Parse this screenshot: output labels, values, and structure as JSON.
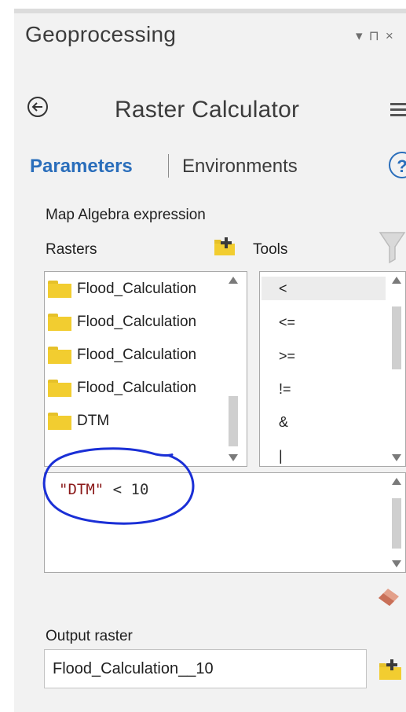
{
  "pane": {
    "title": "Geoprocessing",
    "controls": [
      "▾",
      "⊓",
      "×"
    ]
  },
  "tool": {
    "title": "Raster Calculator"
  },
  "tabs": {
    "parameters": "Parameters",
    "environments": "Environments",
    "help": "?"
  },
  "form": {
    "expression_label": "Map Algebra expression",
    "rasters_label": "Rasters",
    "tools_label": "Tools",
    "output_label": "Output raster",
    "output_value": "Flood_Calculation__10"
  },
  "rasters": [
    {
      "label": "Flood_Calculation"
    },
    {
      "label": "Flood_Calculation"
    },
    {
      "label": "Flood_Calculation"
    },
    {
      "label": "Flood_Calculation"
    },
    {
      "label": "DTM"
    }
  ],
  "tools": [
    {
      "label": "<"
    },
    {
      "label": "<="
    },
    {
      "label": ">="
    },
    {
      "label": "!="
    },
    {
      "label": "&"
    },
    {
      "label": "|"
    }
  ],
  "expression": {
    "raster_ref": "\"DTM\"",
    "rest": " < 10"
  },
  "colors": {
    "accent": "#2a6ebb",
    "annotation": "#1a2fd6",
    "folder": "#f2cd30",
    "string_literal": "#8b1a1a"
  }
}
